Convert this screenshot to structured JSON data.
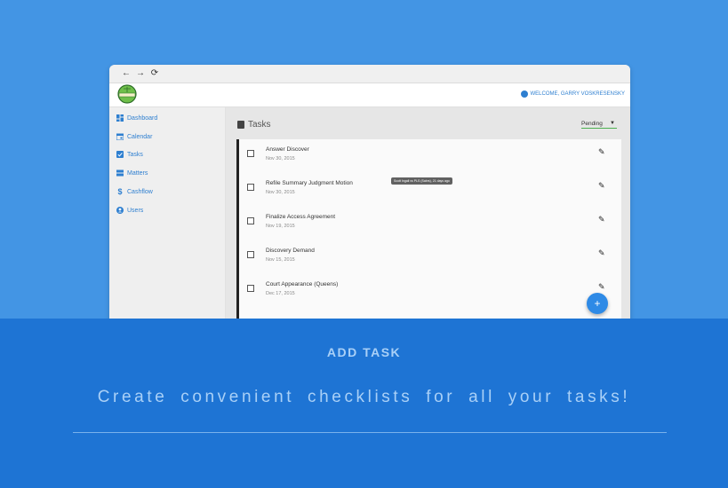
{
  "user": {
    "welcome": "WELCOME, GARRY VOSKRESENSKY"
  },
  "sidebar": {
    "items": [
      {
        "label": "Dashboard",
        "icon": "dashboard-icon"
      },
      {
        "label": "Calendar",
        "icon": "calendar-icon"
      },
      {
        "label": "Tasks",
        "icon": "tasks-icon"
      },
      {
        "label": "Matters",
        "icon": "matters-icon"
      },
      {
        "label": "Cashflow",
        "icon": "dollar-icon"
      },
      {
        "label": "Users",
        "icon": "user-icon"
      }
    ]
  },
  "main": {
    "title": "Tasks",
    "filter_selected": "Pending",
    "tooltip": "Scott Ingall vs PLS (Sabrs), 21 days ago",
    "tasks": [
      {
        "title": "Answer Discover",
        "date": "Nov 30, 2015"
      },
      {
        "title": "Refile Summary Judgment Motion",
        "date": "Nov 30, 2015"
      },
      {
        "title": "Finalize Access Agreement",
        "date": "Nov 19, 2015"
      },
      {
        "title": "Discovery Demand",
        "date": "Nov 15, 2015"
      },
      {
        "title": "Court Appearance (Queens)",
        "date": "Dec 17, 2015"
      }
    ]
  },
  "fab_label": "+",
  "promo": {
    "heading": "ADD TASK",
    "subtitle": "Create convenient checklists for all your tasks!"
  },
  "colors": {
    "accent": "#2e7fd0",
    "page_bg": "#4395e4",
    "bottom_bg": "#1e74d4",
    "promo_text": "#a9d0f7"
  }
}
